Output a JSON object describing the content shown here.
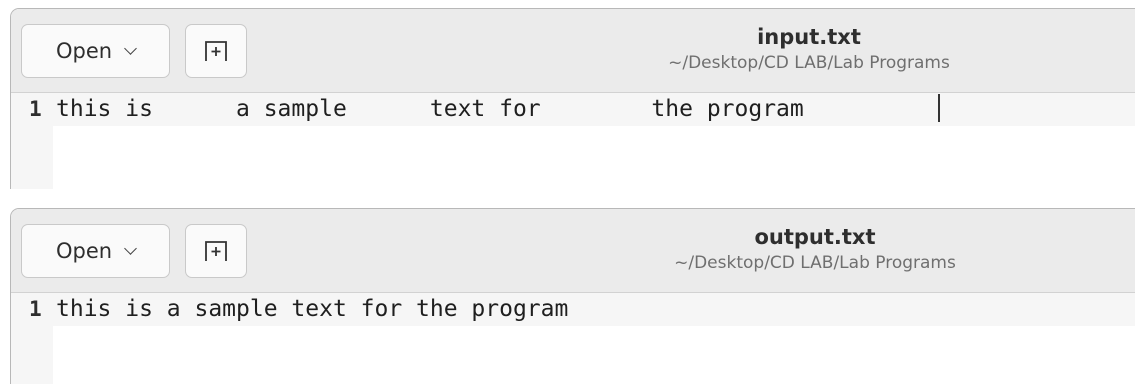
{
  "windows": [
    {
      "open_label": "Open",
      "title": "input.txt",
      "path": "~/Desktop/CD LAB/Lab Programs",
      "line_number": "1",
      "line_text": "this is      a sample      text for        the program "
    },
    {
      "open_label": "Open",
      "title": "output.txt",
      "path": "~/Desktop/CD LAB/Lab Programs",
      "line_number": "1",
      "line_text": "this is a sample text for the program"
    }
  ],
  "icons": {
    "open_menu": "chevron-down-icon",
    "new_document": "new-document-icon"
  },
  "colors": {
    "headerbar": "#ebebeb",
    "gutter": "#f6f6f6",
    "text": "#1f1f1f"
  }
}
